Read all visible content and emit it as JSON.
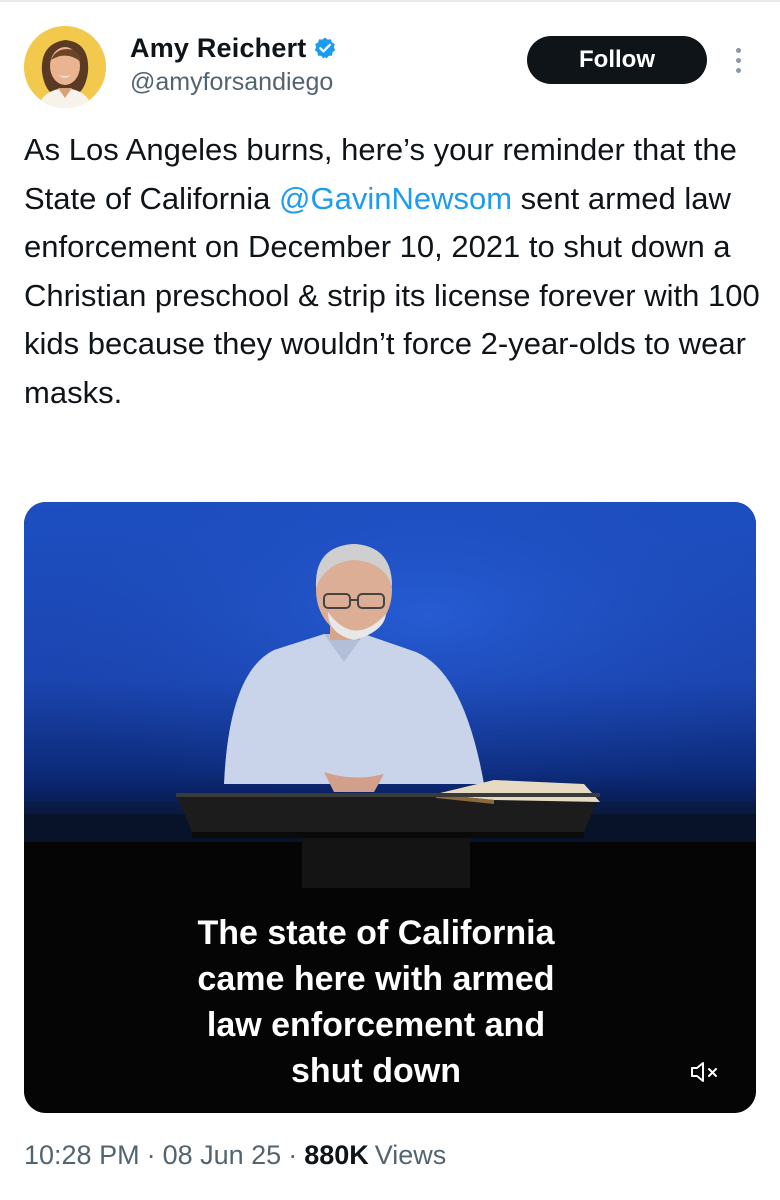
{
  "tweet": {
    "author": {
      "display_name": "Amy Reichert",
      "handle": "@amyforsandiego",
      "verified": true,
      "avatar": "avatar-photo"
    },
    "follow_label": "Follow",
    "more_icon": "more-vertical-icon",
    "text_segments": [
      {
        "type": "text",
        "value": "As Los Angeles burns, here’s your reminder that the State of California "
      },
      {
        "type": "mention",
        "value": "@GavinNewsom"
      },
      {
        "type": "text",
        "value": " sent armed law enforcement on December 10, 2021 to shut down a Christian preschool & strip its license forever with 100 kids because they wouldn’t force 2-year-olds to wear masks."
      }
    ],
    "media": {
      "type": "video",
      "caption_lines": [
        "The state of California",
        "came here with armed",
        "law enforcement and",
        "shut down"
      ],
      "mute_icon": "muted-speaker-icon"
    },
    "meta": {
      "time": "10:28 PM",
      "separator": "·",
      "date": "08 Jun 25",
      "views_count": "880K",
      "views_label": "Views"
    }
  },
  "colors": {
    "link": "#1d9bf0",
    "text": "#0f1419",
    "secondary": "#536471",
    "verified": "#1d9bf0",
    "follow_bg": "#0f1419",
    "media_bg": "#1a4fc4"
  }
}
